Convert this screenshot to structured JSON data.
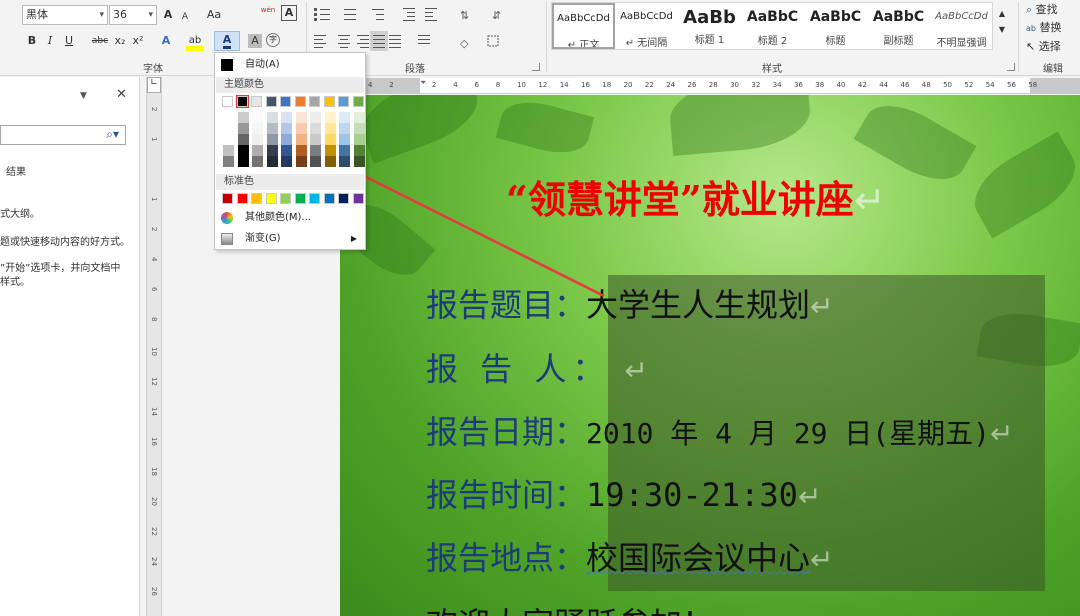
{
  "ribbon": {
    "font_name": "黑体",
    "font_size": "36",
    "group_font": "字体",
    "group_paragraph": "段落",
    "group_styles": "样式",
    "group_editing": "编辑",
    "grow_font": "A",
    "shrink_font": "A",
    "change_case": "Aa",
    "phonetic": "wén",
    "clear_format_label": "A",
    "bold": "B",
    "italic": "I",
    "underline": "U",
    "strike": "abc",
    "subscript": "x₂",
    "superscript": "x²",
    "text_effects": "A",
    "highlight": "ab",
    "font_color": "A",
    "char_shading": "A",
    "enclose": "字",
    "editing": {
      "find": "查找",
      "replace": "替换",
      "select": "选择"
    },
    "styles": [
      {
        "sample": "AaBbCcDd",
        "name": "↵ 正文"
      },
      {
        "sample": "AaBbCcDd",
        "name": "↵ 无间隔"
      },
      {
        "sample": "AaBb",
        "name": "标题 1"
      },
      {
        "sample": "AaBbC",
        "name": "标题 2"
      },
      {
        "sample": "AaBbC",
        "name": "标题"
      },
      {
        "sample": "AaBbC",
        "name": "副标题"
      },
      {
        "sample": "AaBbCcDd",
        "name": "不明显强调"
      }
    ]
  },
  "navpane": {
    "close": "✕",
    "results_label": "结果",
    "text_1": "式大纲。",
    "text_2": "题或快速移动内容的好方式。",
    "text_3": "”开始”选项卡，并向文档中",
    "text_4": "样式。"
  },
  "color_menu": {
    "auto_label": "自动(A)",
    "theme_header": "主题颜色",
    "standard_header": "标准色",
    "more_colors": "其他颜色(M)...",
    "gradient": "渐变(G)",
    "theme_top_row": [
      "#ffffff",
      "#000000",
      "#e7e6e6",
      "#44546a",
      "#4472c4",
      "#ed7d31",
      "#a5a5a5",
      "#ffc000",
      "#5b9bd5",
      "#70ad47"
    ],
    "standard_colors": [
      "#c00000",
      "#ff0000",
      "#ffc000",
      "#ffff00",
      "#92d050",
      "#00b050",
      "#00b0f0",
      "#0070c0",
      "#002060",
      "#7030a0"
    ]
  },
  "hruler_ticks": [
    "4",
    "2",
    "",
    "2",
    "4",
    "6",
    "8",
    "10",
    "12",
    "14",
    "16",
    "18",
    "20",
    "22",
    "24",
    "26",
    "28",
    "30",
    "32",
    "34",
    "36",
    "38",
    "40",
    "42",
    "44",
    "46",
    "48",
    "50",
    "52",
    "54",
    "56",
    "58"
  ],
  "vruler_ticks": [
    "2",
    "1",
    "",
    "1",
    "2",
    "4",
    "6",
    "8",
    "10",
    "12",
    "14",
    "16",
    "18",
    "20",
    "22",
    "24",
    "26",
    "28"
  ],
  "document": {
    "title": "“领慧讲堂”就业讲座",
    "para_mark": "↵",
    "lines": [
      {
        "label": "报告题目：",
        "value": "大学生人生规划"
      },
      {
        "label": "报  告  人：",
        "value": ""
      },
      {
        "label": "报告日期：",
        "value": "2010 年 4 月 29 日(星期五)"
      },
      {
        "label": "报告时间：",
        "value": "19:30-21:30"
      },
      {
        "label": "报告地点：",
        "value": "校国际会议中心"
      },
      {
        "label": "欢迎大家踊跃参加！",
        "value": ""
      }
    ]
  },
  "colors": {
    "title_red": "#f00000",
    "label_blue": "#1c3b7a",
    "arrow_red": "#e8383d"
  }
}
